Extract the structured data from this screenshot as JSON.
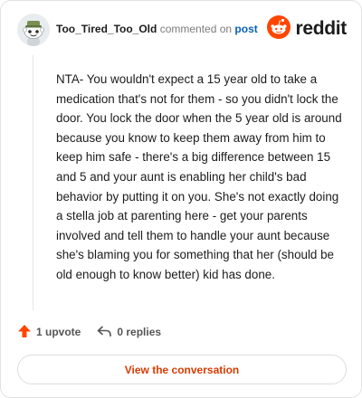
{
  "header": {
    "username": "Too_Tired_Too_Old",
    "action_text": "commented on",
    "post_link": "post",
    "brand_text": "reddit"
  },
  "comment": {
    "body": "NTA- You wouldn't expect a 15 year old to take a medication that's not for them - so you didn't lock the door. You lock the door when the 5 year old is around because you know to keep them away from him to keep him safe - there's a big difference between 15 and 5 and your aunt is enabling her child's bad behavior by putting it on you. She's not exactly doing a stella job at parenting here - get your parents involved and tell them to handle your aunt because she's blaming you for something that her (should be old enough to know better) kid has done."
  },
  "actions": {
    "upvote_label": "1 upvote",
    "reply_label": "0 replies"
  },
  "cta": {
    "label": "View the conversation"
  },
  "colors": {
    "brand_orange": "#ff4500",
    "link_blue": "#0a5fb4",
    "cta_text": "#d93a00"
  },
  "icons": {
    "avatar": "snoo-avatar-icon",
    "brand": "reddit-logo-icon",
    "upvote": "upvote-arrow-icon",
    "reply": "reply-arrow-icon"
  }
}
